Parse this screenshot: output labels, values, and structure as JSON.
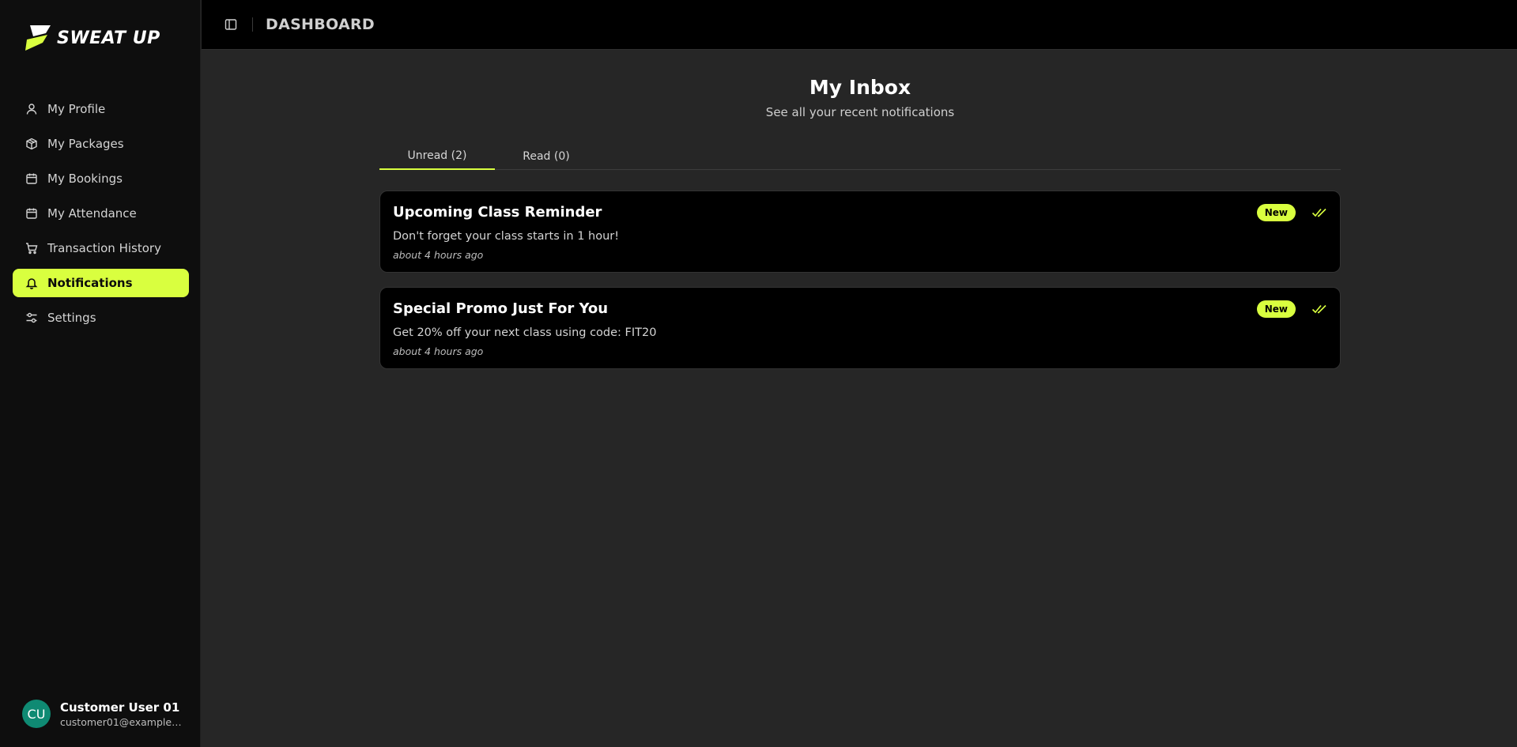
{
  "brand": {
    "name": "SWEAT UP",
    "accent": "#d9ff3f"
  },
  "header": {
    "title": "DASHBOARD",
    "toggle_icon": "sidebar-panel-icon"
  },
  "sidebar": {
    "items": [
      {
        "label": "My Profile",
        "icon": "user-icon",
        "active": false
      },
      {
        "label": "My Packages",
        "icon": "package-icon",
        "active": false
      },
      {
        "label": "My Bookings",
        "icon": "calendar-icon",
        "active": false
      },
      {
        "label": "My Attendance",
        "icon": "calendar-icon",
        "active": false
      },
      {
        "label": "Transaction History",
        "icon": "cart-icon",
        "active": false
      },
      {
        "label": "Notifications",
        "icon": "bell-icon",
        "active": true
      },
      {
        "label": "Settings",
        "icon": "sliders-icon",
        "active": false
      }
    ]
  },
  "user": {
    "initials": "CU",
    "name": "Customer User 01",
    "email": "customer01@example.c..."
  },
  "main": {
    "title": "My Inbox",
    "subtitle": "See all your recent notifications",
    "tabs": [
      {
        "label": "Unread (2)",
        "active": true
      },
      {
        "label": "Read (0)",
        "active": false
      }
    ],
    "notifications": [
      {
        "title": "Upcoming Class Reminder",
        "body": "Don't forget your class starts in 1 hour!",
        "time": "about 4 hours ago",
        "badge": "New"
      },
      {
        "title": "Special Promo Just For You",
        "body": "Get 20% off your next class using code: FIT20",
        "time": "about 4 hours ago",
        "badge": "New"
      }
    ]
  }
}
